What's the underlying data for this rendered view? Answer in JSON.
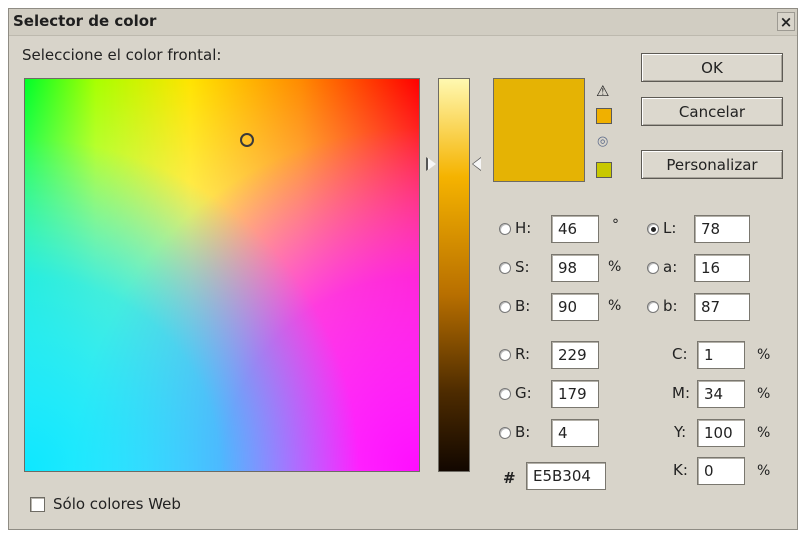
{
  "window": {
    "title": "Selector de color",
    "close_label": "×"
  },
  "prompt": "Seleccione el color frontal:",
  "buttons": {
    "ok": "OK",
    "cancel": "Cancelar",
    "custom": "Personalizar"
  },
  "colors": {
    "current": "#E5B304",
    "gamut_warning": "#F0B000",
    "web_safe": "#C8C800"
  },
  "icons": {
    "gamut_warning": "warning-icon",
    "web_safe": "cube-icon"
  },
  "hsb": {
    "h": {
      "label": "H:",
      "value": "46",
      "unit": "°",
      "selected": false
    },
    "s": {
      "label": "S:",
      "value": "98",
      "unit": "%",
      "selected": false
    },
    "b": {
      "label": "B:",
      "value": "90",
      "unit": "%",
      "selected": false
    }
  },
  "lab": {
    "l": {
      "label": "L:",
      "value": "78",
      "selected": true
    },
    "a": {
      "label": "a:",
      "value": "16",
      "selected": false
    },
    "b": {
      "label": "b:",
      "value": "87",
      "selected": false
    }
  },
  "rgb": {
    "r": {
      "label": "R:",
      "value": "229",
      "selected": false
    },
    "g": {
      "label": "G:",
      "value": "179",
      "selected": false
    },
    "b": {
      "label": "B:",
      "value": "4",
      "selected": false
    }
  },
  "cmyk": {
    "c": {
      "label": "C:",
      "value": "1",
      "unit": "%"
    },
    "m": {
      "label": "M:",
      "value": "34",
      "unit": "%"
    },
    "y": {
      "label": "Y:",
      "value": "100",
      "unit": "%"
    },
    "k": {
      "label": "K:",
      "value": "0",
      "unit": "%"
    }
  },
  "hex": {
    "label": "#",
    "value": "E5B304"
  },
  "web_only": {
    "label": "Sólo colores Web",
    "checked": false
  }
}
